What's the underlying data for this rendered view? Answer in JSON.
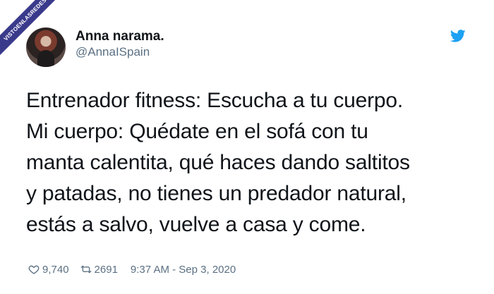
{
  "watermark": {
    "text": "VISTOENLASREDES"
  },
  "author": {
    "name": "Anna narama.",
    "handle": "@AnnaISpain",
    "avatar_icon": "profile-avatar"
  },
  "brand": {
    "icon": "twitter-bird-icon",
    "color": "#1da1f2"
  },
  "tweet": {
    "text": "Entrenador fitness: Escucha a tu cuerpo.\nMi cuerpo: Quédate en el sofá con tu\nmanta calentita, qué haces dando saltitos\ny patadas, no tienes un predador natural,\nestás a salvo, vuelve a casa y come."
  },
  "stats": {
    "likes": "9,740",
    "retweets": "2691",
    "timestamp": "9:37 AM - Sep 3, 2020",
    "like_icon": "heart-icon",
    "retweet_icon": "retweet-icon"
  }
}
